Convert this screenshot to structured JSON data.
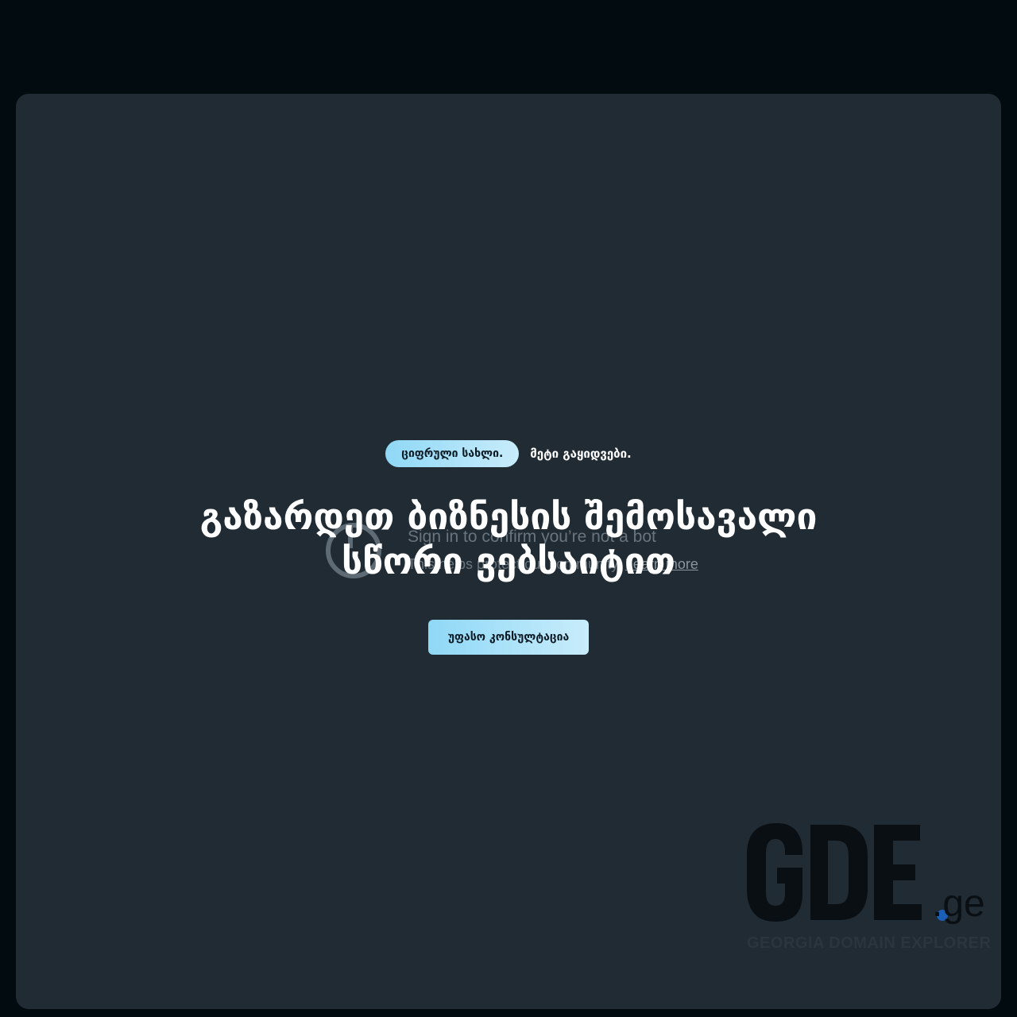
{
  "hero": {
    "pill_label": "ციფრული სახლი.",
    "tagline": "მეტი გაყიდვები.",
    "headline_line1": "გაზარდეთ ბიზნესის შემოსავალი",
    "headline_line2": "სწორი ვებსაიტით",
    "cta_label": "უფასო კონსულტაცია"
  },
  "bot_check": {
    "title": "Sign in to confirm you’re not a bot",
    "subtitle": "This helps protect our community.",
    "learn_more": "Learn more"
  },
  "logo": {
    "wordmark": "GDE",
    "tld": ".ge",
    "tagline": "GEORGIA DOMAIN EXPLORER",
    "dot_color": "#1a5fb4",
    "mark_color": "#0a0f13",
    "tagline_color": "#2a353d"
  }
}
